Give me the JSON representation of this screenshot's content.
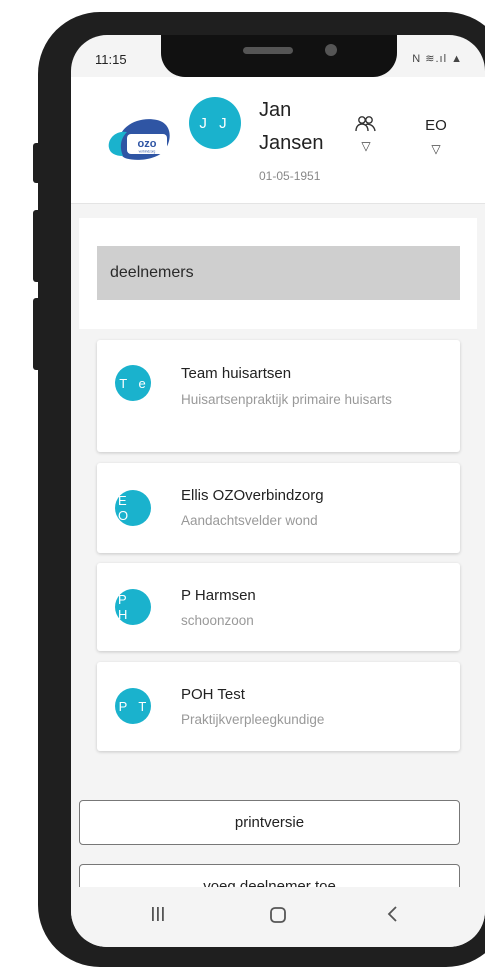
{
  "status": {
    "time": "11:15",
    "icons": "N ≋.ıl ▲"
  },
  "header": {
    "logo_text": "ozo",
    "logo_subtext": "verbindzorg",
    "avatar_initials": "J J",
    "patient_first_name": "Jan",
    "patient_last_name": "Jansen",
    "patient_dob": "01-05-1951",
    "user_initials": "EO",
    "dropdown_glyph": "▽"
  },
  "section": {
    "title": "deelnemers"
  },
  "participants": [
    {
      "initials": "T e",
      "name": "Team huisartsen",
      "role": "Huisartsenpraktijk primaire huisarts"
    },
    {
      "initials": "E O",
      "name": "Ellis OZOverbindzorg",
      "role": "Aandachtsvelder wond"
    },
    {
      "initials": "P H",
      "name": "P Harmsen",
      "role": "schoonzoon"
    },
    {
      "initials": "P T",
      "name": "POH Test",
      "role": "Praktijkverpleegkundige"
    }
  ],
  "buttons": {
    "print": "printversie",
    "add": "voeg deelnemer toe"
  },
  "colors": {
    "accent": "#1ab2cd",
    "logo_blue": "#2f55a4"
  }
}
